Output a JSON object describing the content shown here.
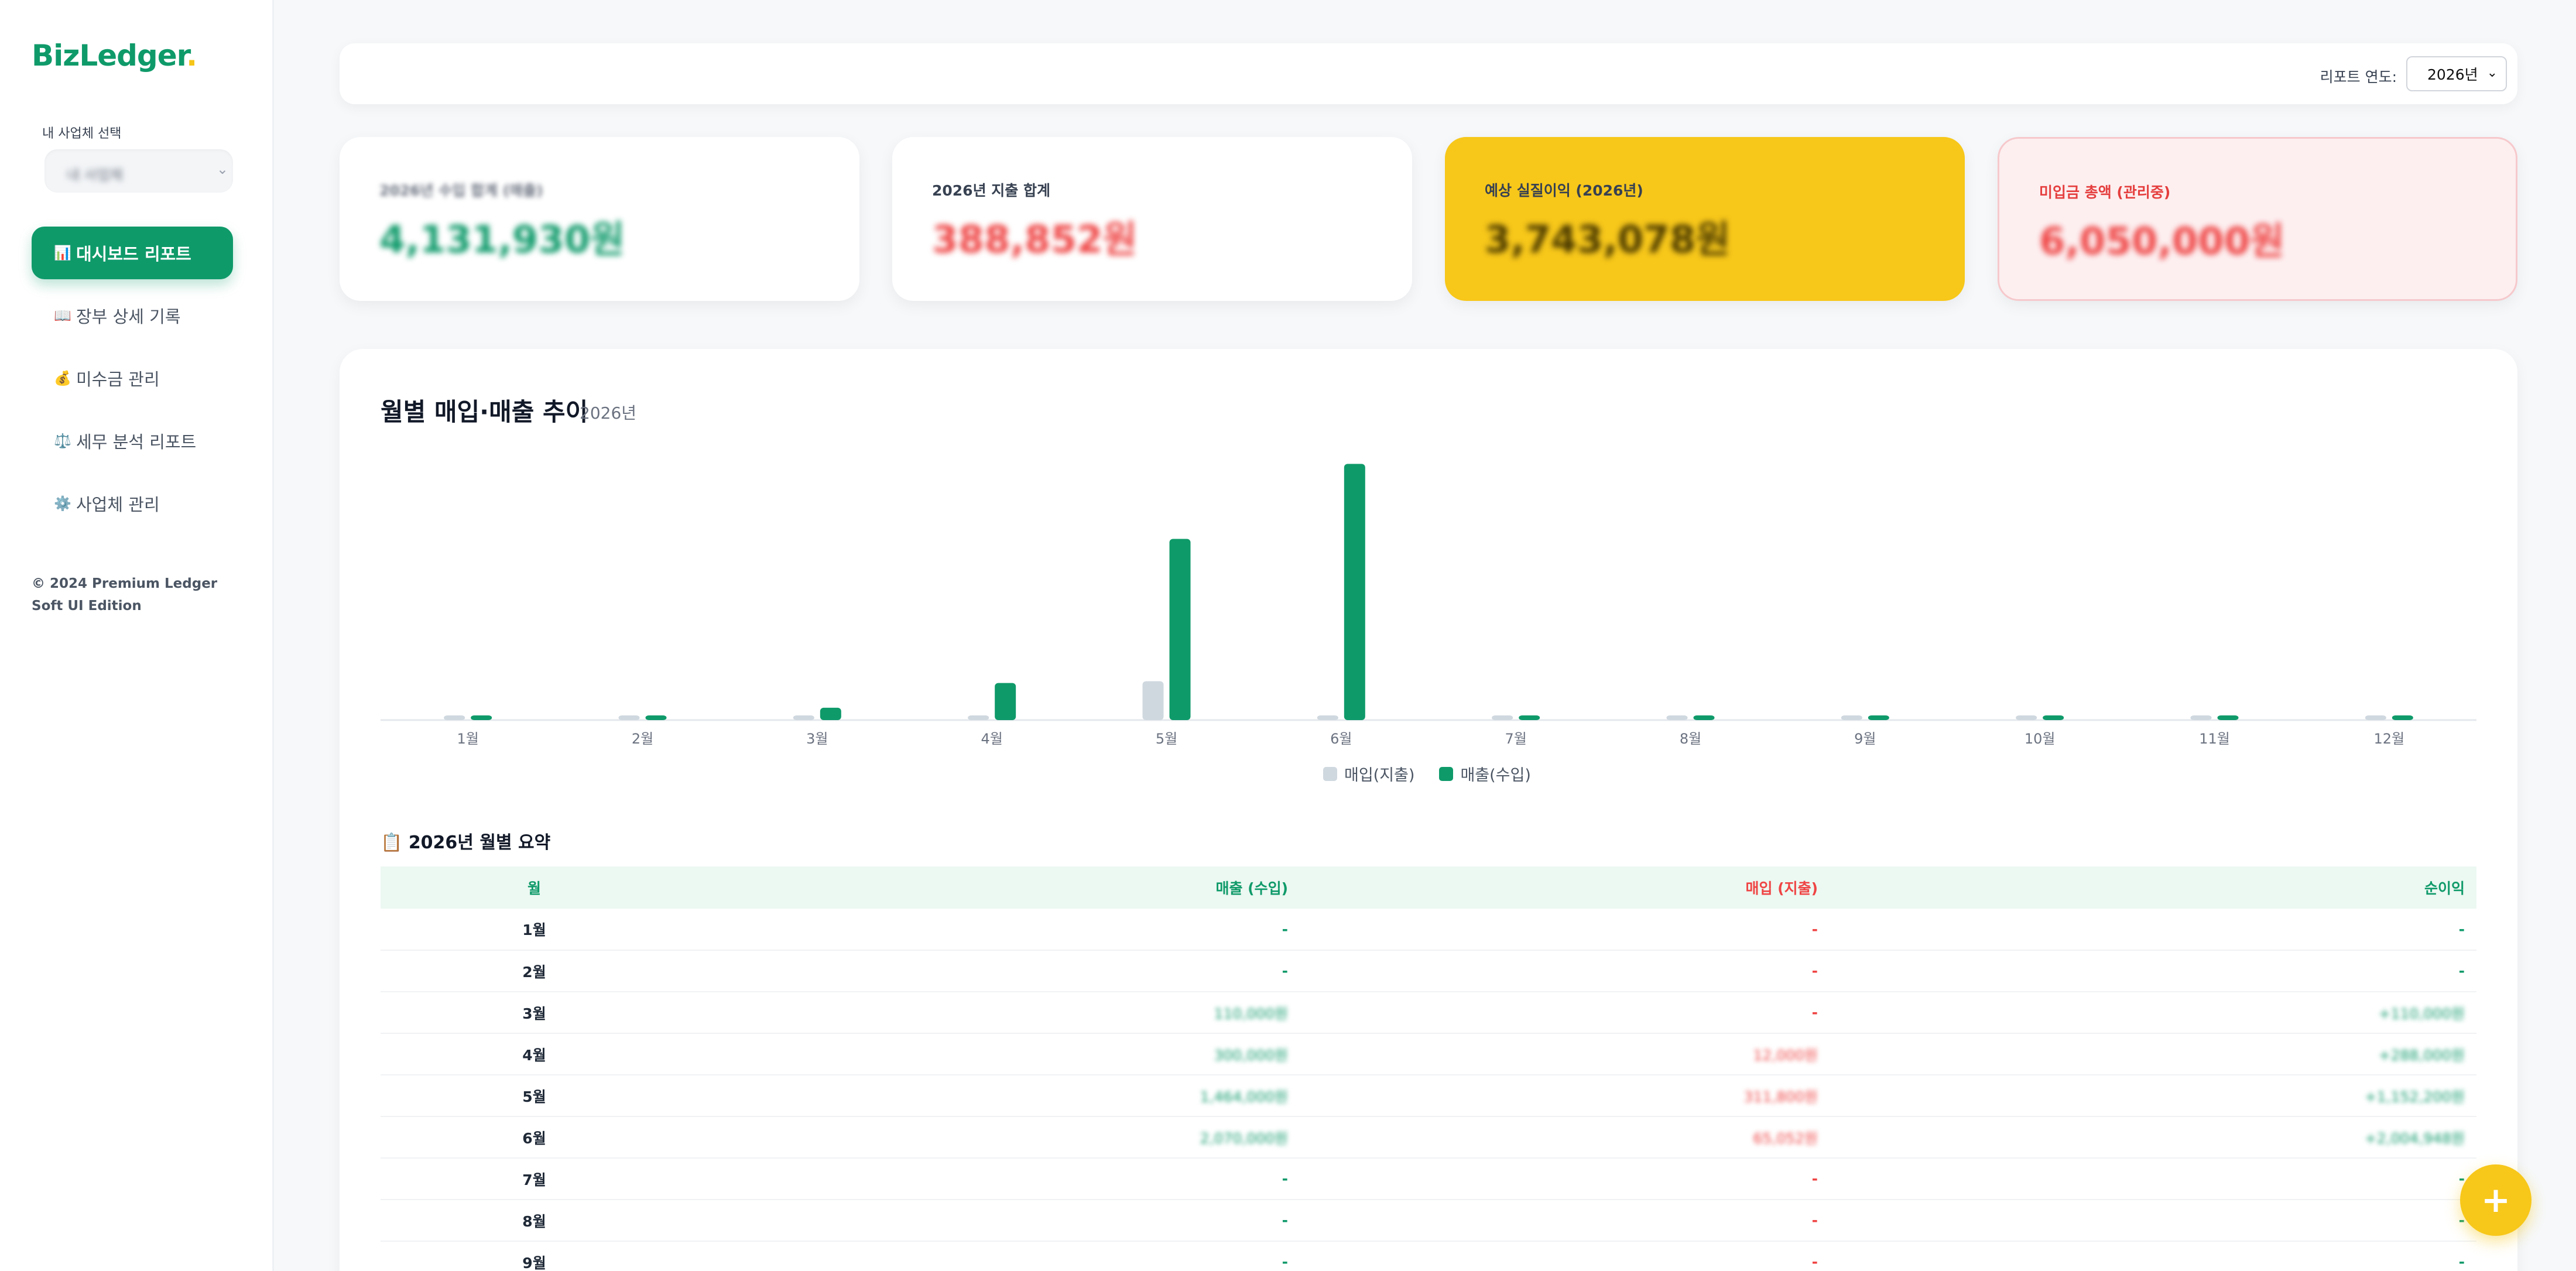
{
  "app": {
    "logo": "BizLedger",
    "logo_dot": "."
  },
  "sidebar": {
    "business_label": "내 사업체 선택",
    "business_value": "내 사업체",
    "items": [
      {
        "icon": "📊",
        "icon_name": "chart-icon",
        "label": "대시보드 리포트",
        "active": true
      },
      {
        "icon": "📖",
        "icon_name": "book-icon",
        "label": "장부 상세 기록"
      },
      {
        "icon": "💰",
        "icon_name": "money-bag-icon",
        "label": "미수금 관리"
      },
      {
        "icon": "⚖️",
        "icon_name": "scale-icon",
        "label": "세무 분석 리포트"
      },
      {
        "icon": "⚙️",
        "icon_name": "gear-icon",
        "label": "사업체 관리"
      }
    ],
    "copyright_line1": "© 2024 Premium Ledger",
    "copyright_line2": "Soft UI Edition"
  },
  "topbar": {
    "year_label": "리포트 연도:",
    "year_value": "2026년"
  },
  "cards": {
    "income": {
      "label": "2026년 수입 합계 (매출)",
      "value": "4,131,930원"
    },
    "expense": {
      "label": "2026년 지출 합계",
      "value": "388,852원"
    },
    "profit": {
      "label": "예상 실질이익 (2026년)",
      "value": "3,743,078원"
    },
    "unpaid": {
      "label": "미입금 총액 (관리중)",
      "value": "6,050,000원"
    }
  },
  "chart": {
    "title": "월별 매입·매출 추이",
    "subtitle": "2026년"
  },
  "chart_data": {
    "type": "bar",
    "categories": [
      "1월",
      "2월",
      "3월",
      "4월",
      "5월",
      "6월",
      "7월",
      "8월",
      "9월",
      "10월",
      "11월",
      "12월"
    ],
    "series": [
      {
        "name": "매입(지출)",
        "color": "#cfd8df",
        "values": [
          0,
          0,
          0,
          0,
          313800,
          0,
          0,
          0,
          0,
          0,
          0,
          0
        ]
      },
      {
        "name": "매출(수입)",
        "color": "#0f9a6a",
        "values": [
          0,
          0,
          100000,
          300000,
          1464000,
          2070000,
          0,
          0,
          0,
          0,
          0,
          0
        ]
      }
    ],
    "ylim": [
      0,
      2100000
    ],
    "legend_position": "bottom",
    "grid": false
  },
  "table": {
    "title": "2026년 월별 요약",
    "title_icon": "📋",
    "headers": {
      "month": "월",
      "sales": "매출 (수입)",
      "purchase": "매입 (지출)",
      "net": "순이익"
    },
    "rows": [
      {
        "month": "1월",
        "sales": "-",
        "purchase": "-",
        "net": "-"
      },
      {
        "month": "2월",
        "sales": "-",
        "purchase": "-",
        "net": "-"
      },
      {
        "month": "3월",
        "sales": "110,000원",
        "purchase": "-",
        "net": "+110,000원"
      },
      {
        "month": "4월",
        "sales": "300,000원",
        "purchase": "12,000원",
        "net": "+288,000원"
      },
      {
        "month": "5월",
        "sales": "1,464,000원",
        "purchase": "311,800원",
        "net": "+1,152,200원"
      },
      {
        "month": "6월",
        "sales": "2,070,000원",
        "purchase": "65,052원",
        "net": "+2,004,948원"
      },
      {
        "month": "7월",
        "sales": "-",
        "purchase": "-",
        "net": "-"
      },
      {
        "month": "8월",
        "sales": "-",
        "purchase": "-",
        "net": "-"
      },
      {
        "month": "9월",
        "sales": "-",
        "purchase": "-",
        "net": "-"
      }
    ]
  },
  "fab": {
    "label": "+"
  },
  "colors": {
    "accent": "#0f9a6a",
    "yellow": "#f7c71a",
    "red": "#ef4444"
  }
}
